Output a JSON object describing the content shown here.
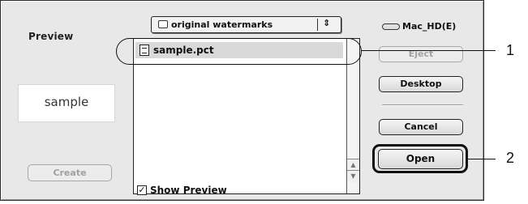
{
  "dialog": {
    "preview_title": "Preview",
    "preview_text": "sample",
    "create_label": "Create"
  },
  "folder_popup": {
    "label": "original watermarks",
    "arrows": "⇕"
  },
  "file_list": {
    "items": [
      {
        "name": "sample.pct",
        "selected": true
      }
    ],
    "scroll_up": "▲",
    "scroll_down": "▼"
  },
  "show_preview": {
    "label": "Show Preview",
    "checked": true,
    "check_mark": "✓"
  },
  "volume": {
    "label": "Mac_HD(E)"
  },
  "buttons": {
    "eject": "Eject",
    "desktop": "Desktop",
    "cancel": "Cancel",
    "open": "Open"
  },
  "callouts": {
    "one": "1",
    "two": "2"
  }
}
